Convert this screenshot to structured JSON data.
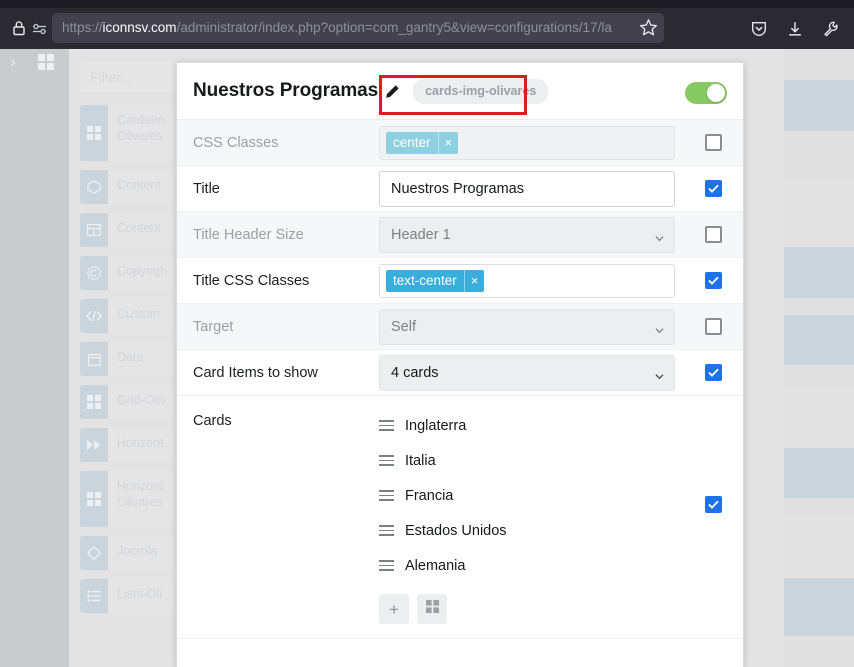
{
  "browser": {
    "url_full": "https://iconnsv.com/administrator/index.php?option=com_gantry5&view=configurations/17/la",
    "url_scheme": "https://",
    "url_host": "iconnsv.com",
    "url_path": "/administrator/index.php?option=com_gantry5&view=configurations/17/la",
    "icons": {
      "lock": "lock-icon",
      "permissions": "site-permissions-icon",
      "bookmark": "star-icon",
      "pocket": "pocket-shield-icon",
      "download": "download-icon",
      "tools": "wrench-icon"
    }
  },
  "admin": {
    "rail": {
      "chevron": "›",
      "grid": "grid-icon"
    },
    "filter": {
      "placeholder": "Filter..."
    },
    "particles": [
      {
        "label": "CardsIm\nOlivares",
        "icon": "grid-icon",
        "tall": true
      },
      {
        "label": "Content",
        "icon": "box-icon",
        "tall": false
      },
      {
        "label": "Content",
        "icon": "table-icon",
        "tall": false
      },
      {
        "label": "Copyrigh",
        "icon": "copyright-icon",
        "tall": false
      },
      {
        "label": "Custom",
        "icon": "code-icon",
        "tall": false
      },
      {
        "label": "Date",
        "icon": "calendar-icon",
        "tall": false
      },
      {
        "label": "Grid-Oliv",
        "icon": "grid-icon",
        "tall": false
      },
      {
        "label": "Horizont",
        "icon": "forward-icon",
        "tall": false
      },
      {
        "label": "Horizont\nOlivares",
        "icon": "grid-icon",
        "tall": true
      },
      {
        "label": "Joomla ",
        "icon": "joomla-icon",
        "tall": false
      },
      {
        "label": "Lists-Oli",
        "icon": "list-icon",
        "tall": false
      }
    ]
  },
  "modal": {
    "title": "Nuestros Programas",
    "edit_icon": "pencil-icon",
    "id_badge": "cards-img-olivares",
    "enabled_toggle": "on",
    "toggle_color": "#87c963",
    "accent_checkbox": "#1a73e8",
    "highlight_color": "#e01b1b",
    "rows": [
      {
        "label": "CSS Classes",
        "type": "tags",
        "tags": [
          {
            "text": "center",
            "remove": "×"
          }
        ],
        "disabled": true,
        "checked": false
      },
      {
        "label": "Title",
        "type": "text",
        "value": "Nuestros Programas",
        "disabled": false,
        "checked": true
      },
      {
        "label": "Title Header Size",
        "type": "select",
        "value": "Header 1",
        "disabled": true,
        "checked": false
      },
      {
        "label": "Title CSS Classes",
        "type": "tags",
        "tags": [
          {
            "text": "text-center",
            "remove": "×"
          }
        ],
        "disabled": false,
        "checked": true
      },
      {
        "label": "Target",
        "type": "select",
        "value": "Self",
        "disabled": true,
        "checked": false
      },
      {
        "label": "Card Items to show",
        "type": "select",
        "value": "4 cards",
        "disabled": false,
        "checked": true
      }
    ],
    "cards_row": {
      "label": "Cards",
      "checked": true,
      "items": [
        "Inglaterra",
        "Italia",
        "Francia",
        "Estados Unidos",
        "Alemania"
      ],
      "add_button": "+",
      "picker_button": "grid-icon"
    }
  }
}
